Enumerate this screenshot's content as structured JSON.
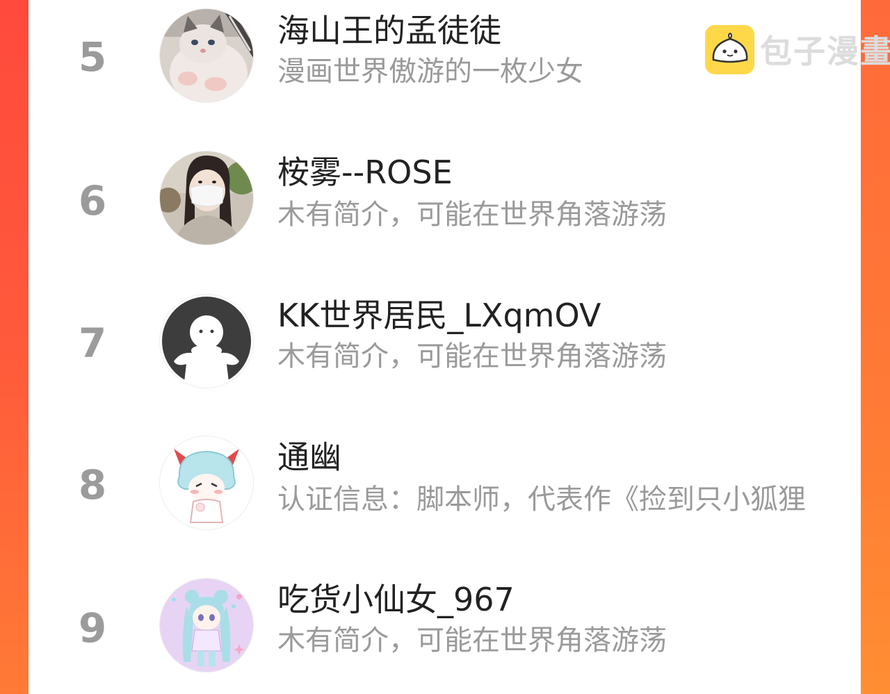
{
  "watermark": {
    "text": "包子漫畫",
    "logo_icon": "bun-logo-icon"
  },
  "ranking": [
    {
      "rank": "5",
      "name": "海山王的孟徒徒",
      "desc": "漫画世界傲游的一枚少女",
      "avatar": "cat-photo-avatar"
    },
    {
      "rank": "6",
      "name": "桉雾--ROSE",
      "desc": "木有简介，可能在世界角落游荡",
      "avatar": "masked-girl-photo-avatar"
    },
    {
      "rank": "7",
      "name": "KK世界居民_LXqmOV",
      "desc": "木有简介，可能在世界角落游荡",
      "avatar": "default-ghost-avatar"
    },
    {
      "rank": "8",
      "name": "通幽",
      "desc": "认证信息：脚本师，代表作《捡到只小狐狸",
      "avatar": "anime-devil-boy-avatar"
    },
    {
      "rank": "9",
      "name": "吃货小仙女_967",
      "desc": "木有简介，可能在世界角落游荡",
      "avatar": "anime-girl-avatar"
    }
  ],
  "colors": {
    "background_left": "#ff4a3d",
    "background_right": "#ff7b36",
    "rank": "#9b9b9b",
    "name": "#222222",
    "desc": "#9a9a9a",
    "logo": "#ffd84a"
  }
}
